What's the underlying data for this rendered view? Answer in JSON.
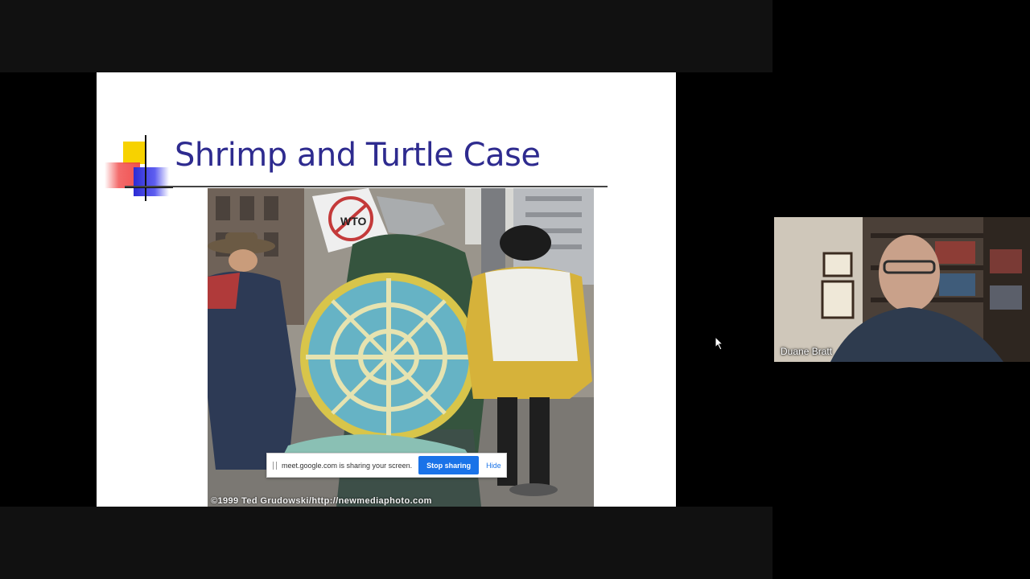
{
  "slide": {
    "title": "Shrimp and Turtle Case",
    "photo_credit": "©1999 Ted Grudowski/http://newmediaphoto.com",
    "sign_text": "WTO",
    "icons": [
      "slide-bullet-decoration"
    ]
  },
  "share_notice": {
    "text": "meet.google.com is sharing your screen.",
    "stop_label": "Stop sharing",
    "hide_label": "Hide",
    "accent_color": "#1a73e8"
  },
  "participant": {
    "name": "Duane Bratt"
  },
  "colors": {
    "title": "#2e2b8f",
    "background": "#000000"
  }
}
